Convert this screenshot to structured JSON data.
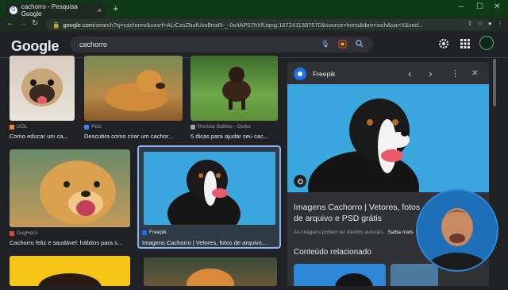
{
  "browser": {
    "tab_title": "cachorro - Pesquisa Google",
    "tab_close": "×",
    "new_tab": "+",
    "url_host": "google.com",
    "url_rest": "/search?q=cachorro&sxsrf=ALiCzsZbufUvx8md9-_-0s4AP07hXfUqng:1672411387570&source=lnms&tbm=isch&sa=X&ved...",
    "win_min": "–",
    "win_max": "☐",
    "win_close": "✕"
  },
  "header": {
    "logo": "Google",
    "query": "cachorro"
  },
  "results": [
    {
      "source": "UOL",
      "caption": "Como educar um ca...",
      "color": "#f28b30"
    },
    {
      "source": "Petz",
      "caption": "Descubra como criar um cachor...",
      "color": "#3c82f6"
    },
    {
      "source": "Revista Galileu - Globo",
      "caption": "5 dicas para ajudar seu cac...",
      "color": "#9aa0a6"
    },
    {
      "source": "DogHero",
      "caption": "Cachorro feliz e saudável: hábitos para s...",
      "color": "#e8453c"
    },
    {
      "source": "Freepik",
      "caption": "Imagens Cachorro | Vetores, fotos de arquivo...",
      "color": "#1a73e8"
    }
  ],
  "panel": {
    "source": "Freepik",
    "title": "Imagens Cachorro | Vetores, fotos de arquivo e PSD grátis",
    "note": "As imagens podem ter direitos autorais.",
    "note_link": "Saiba mais",
    "related": "Conteúdo relacionado",
    "prev": "‹",
    "next": "›",
    "more": "⋮",
    "close": "✕"
  },
  "colors": {
    "accent_blue": "#8ab4f8",
    "selected_outline": "#8ab4f8",
    "panel_bg": "#303134",
    "titlebar": "#0f3a1a"
  }
}
